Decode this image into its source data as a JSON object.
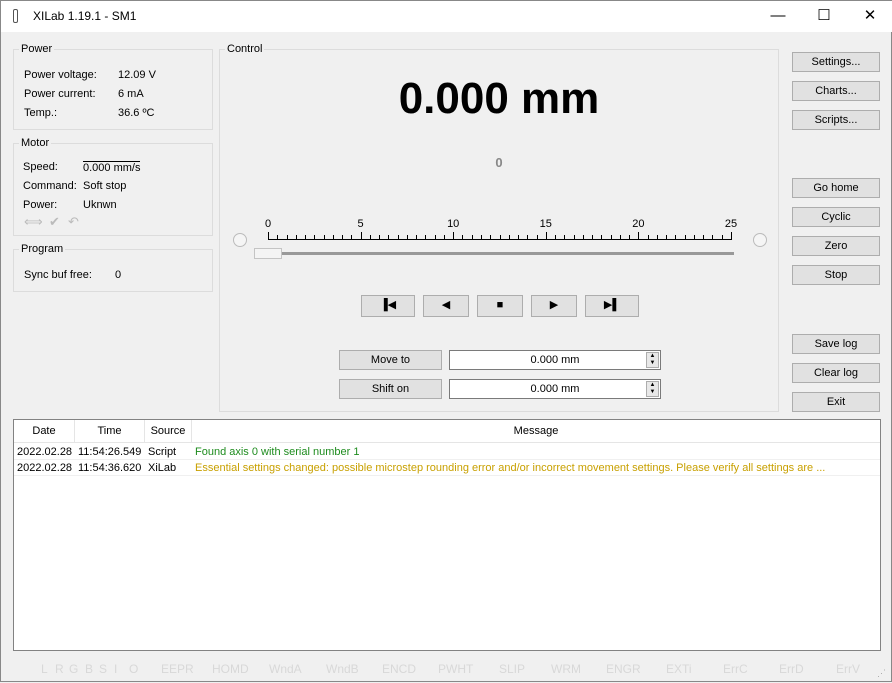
{
  "window": {
    "title": "XILab 1.19.1 - SM1",
    "minimize": "—",
    "maximize": "☐",
    "close": "✕"
  },
  "power": {
    "label": "Power",
    "rows": [
      {
        "k": "Power voltage:",
        "v": "12.09 V"
      },
      {
        "k": "Power current:",
        "v": "6 mA"
      },
      {
        "k": "Temp.:",
        "v": "36.6 ºC"
      }
    ]
  },
  "motor": {
    "label": "Motor",
    "rows": [
      {
        "k": "Speed:",
        "v": "0.000 mm/s"
      },
      {
        "k": "Command:",
        "v": "Soft stop"
      },
      {
        "k": "Power:",
        "v": "Uknwn"
      }
    ]
  },
  "program": {
    "label": "Program",
    "k": "Sync buf free:",
    "v": "0"
  },
  "control": {
    "label": "Control",
    "position": "0.000 mm",
    "steps": "0",
    "ruler": {
      "min": 0,
      "max": 25,
      "labels": [
        "0",
        "5",
        "10",
        "15",
        "20",
        "25"
      ],
      "slider_value": 0
    },
    "move_to": "Move to",
    "move_to_value": "0.000 mm",
    "shift_on": "Shift on",
    "shift_on_value": "0.000 mm"
  },
  "buttons": {
    "settings": "Settings...",
    "charts": "Charts...",
    "scripts": "Scripts...",
    "go_home": "Go home",
    "cyclic": "Cyclic",
    "zero": "Zero",
    "stop": "Stop",
    "save_log": "Save log",
    "clear_log": "Clear log",
    "exit": "Exit"
  },
  "log": {
    "headers": [
      "Date",
      "Time",
      "Source",
      "Message"
    ],
    "rows": [
      {
        "date": "2022.02.28",
        "time": "11:54:26.549",
        "source": "Script",
        "message": "Found axis 0 with serial number 1",
        "color": "#1e8c1e"
      },
      {
        "date": "2022.02.28",
        "time": "11:54:36.620",
        "source": "XiLab",
        "message": "Essential settings changed: possible microstep rounding error and/or incorrect movement settings. Please verify all settings are ...",
        "color": "#c8a000"
      }
    ]
  },
  "status_flags": [
    "L",
    "R",
    "G",
    "B",
    "S",
    "I",
    "O",
    "EEPR",
    "HOMD",
    "WndA",
    "WndB",
    "ENCD",
    "PWHT",
    "SLIP",
    "WRM",
    "ENGR",
    "EXTi",
    "ErrC",
    "ErrD",
    "ErrV"
  ]
}
